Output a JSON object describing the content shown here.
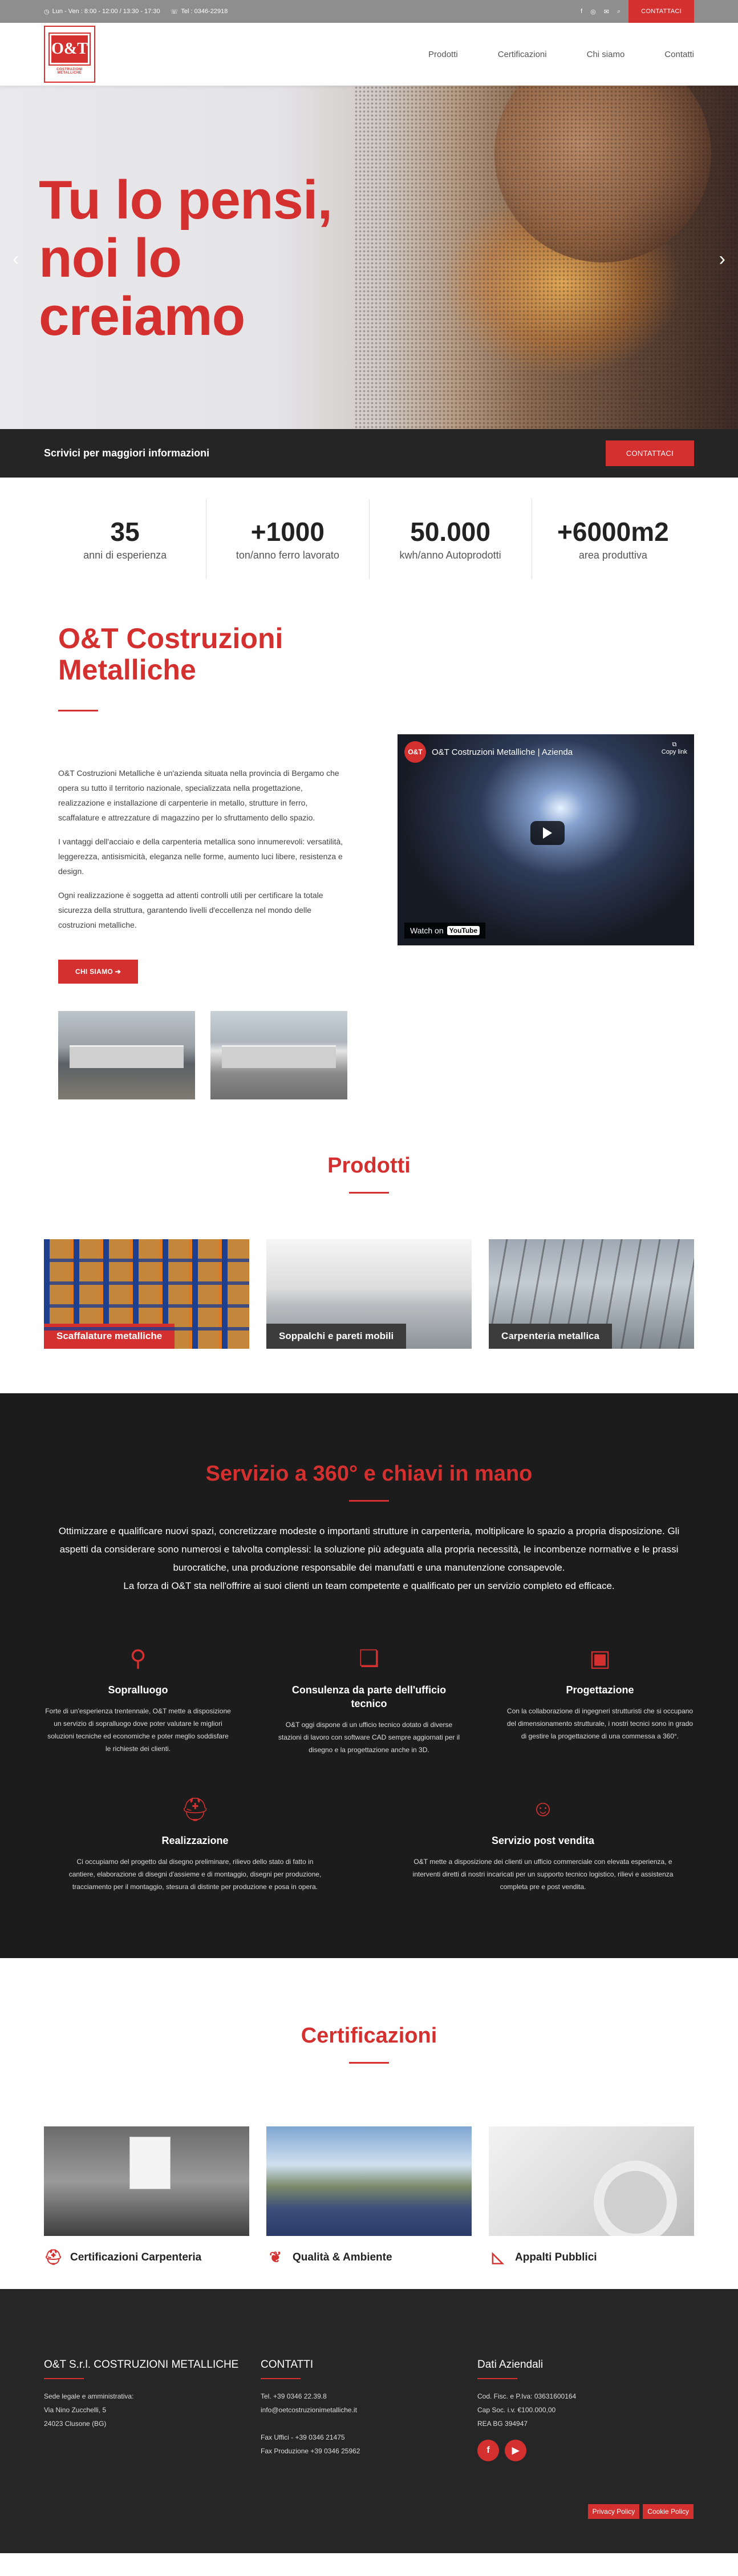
{
  "topbar": {
    "hours": "Lun - Ven : 8:00 - 12:00 / 13:30 - 17:30",
    "phone": "Tel : 0346-22918",
    "cta": "CONTATTACI"
  },
  "header": {
    "logo_text": "O&T",
    "logo_sub": "COSTRUZIONI METALLICHE",
    "nav": [
      "Prodotti",
      "Certificazioni",
      "Chi siamo",
      "Contatti"
    ]
  },
  "hero": {
    "title": "Tu lo pensi,\nnoi lo\ncreiamo"
  },
  "cta_band": {
    "text": "Scrivici per maggiori informazioni",
    "button": "CONTATTACI"
  },
  "stats": [
    {
      "num": "35",
      "label": "anni di esperienza"
    },
    {
      "num": "+1000",
      "label": "ton/anno ferro lavorato"
    },
    {
      "num": "50.000",
      "label": "kwh/anno Autoprodotti"
    },
    {
      "num": "+6000m2",
      "label": "area produttiva"
    }
  ],
  "about": {
    "title": "O&T Costruzioni Metalliche",
    "p1": "O&T Costruzioni Metalliche è un'azienda situata nella provincia di Bergamo che opera su tutto il territorio nazionale, specializzata nella progettazione, realizzazione e installazione di carpenterie in metallo, strutture in ferro, scaffalature e attrezzature di magazzino per lo sfruttamento dello spazio.",
    "p2": "I vantaggi dell'acciaio e della carpenteria metallica sono innumerevoli: versatilità, leggerezza, antisismicità, eleganza nelle forme, aumento luci libere, resistenza e design.",
    "p3": "Ogni realizzazione è soggetta ad attenti controlli utili per certificare la totale sicurezza della struttura, garantendo livelli d'eccellenza nel mondo delle costruzioni metalliche.",
    "button": "CHI SIAMO",
    "video_title": "O&T Costruzioni Metalliche | Azienda",
    "video_copy": "Copy link",
    "video_watch": "Watch on",
    "video_yt": "YouTube"
  },
  "prodotti": {
    "title": "Prodotti",
    "items": [
      "Scaffalature metalliche",
      "Soppalchi e pareti mobili",
      "Carpenteria metallica"
    ]
  },
  "servizio": {
    "title": "Servizio a 360° e chiavi in mano",
    "intro": "Ottimizzare e qualificare nuovi spazi, concretizzare modeste o importanti strutture in carpenteria, moltiplicare lo spazio a propria disposizione. Gli aspetti da considerare sono numerosi e talvolta complessi: la soluzione più adeguata alla propria necessità, le incombenze normative e le prassi burocratiche, una produzione responsabile dei manufatti e una manutenzione consapevole.\nLa forza di O&T sta nell'offrire ai suoi clienti un team competente e qualificato per un servizio completo ed efficace.",
    "items": [
      {
        "icon": "magnifier-icon",
        "title": "Sopralluogo",
        "desc": "Forte di un'esperienza trentennale, O&T mette a disposizione un servizio di sopralluogo dove poter valutare le migliori soluzioni tecniche ed economiche e poter meglio soddisfare le richieste dei clienti."
      },
      {
        "icon": "chat-icon",
        "title": "Consulenza da parte dell'ufficio tecnico",
        "desc": "O&T oggi dispone di un ufficio tecnico dotato di diverse stazioni di lavoro con software CAD sempre aggiornati per il disegno e la progettazione anche in 3D."
      },
      {
        "icon": "blueprint-icon",
        "title": "Progettazione",
        "desc": "Con la collaborazione di ingegneri strutturisti che si occupano del dimensionamento strutturale, i nostri tecnici sono in grado di gestire la progettazione di una commessa a 360°."
      },
      {
        "icon": "helmet-icon",
        "title": "Realizzazione",
        "desc": "Ci occupiamo del progetto dal disegno preliminare, rilievo dello stato di fatto in cantiere, elaborazione di disegni d'assieme e di montaggio, disegni per produzione, tracciamento per il montaggio, stesura di distinte per produzione e posa in opera."
      },
      {
        "icon": "support-icon",
        "title": "Servizio post vendita",
        "desc": "O&T mette a disposizione dei clienti un ufficio commerciale con elevata esperienza, e interventi diretti di nostri incaricati per un supporto tecnico logistico, rilievi e assistenza completa pre e post vendita."
      }
    ]
  },
  "certificazioni": {
    "title": "Certificazioni",
    "items": [
      "Certificazioni Carpenteria",
      "Qualità & Ambiente",
      "Appalti Pubblici"
    ]
  },
  "footer": {
    "col1_title": "O&T S.r.l. COSTRUZIONI METALLICHE",
    "col1_lines": [
      "Sede legale e amministrativa:",
      "Via Nino Zucchelli, 5",
      "24023 Clusone (BG)"
    ],
    "col2_title": "CONTATTI",
    "col2_lines": [
      "Tel. +39 0346 22.39.8",
      "info@oetcostruzionimetalliche.it",
      "",
      "Fax Uffici - +39 0346 21475",
      "Fax Produzione +39 0346 25962"
    ],
    "col3_title": "Dati Aziendali",
    "col3_lines": [
      "Cod. Fisc. e P.Iva: 03631600164",
      "Cap Soc. i.v. €100.000,00",
      "REA BG 394947"
    ],
    "privacy": "Privacy Policy",
    "cookie": "Cookie Policy"
  },
  "colors": {
    "accent": "#d3302f",
    "dark": "#1c1c1c",
    "band": "#252525",
    "topbar": "#8e8e8e"
  }
}
